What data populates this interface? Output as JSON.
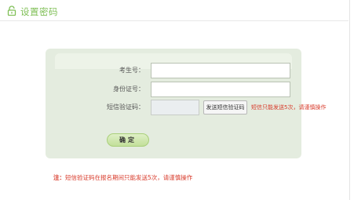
{
  "header": {
    "title": "设置密码"
  },
  "form": {
    "exam_id_label": "考生号：",
    "id_card_label": "身份证号：",
    "sms_code_label": "短信验证码：",
    "exam_id_value": "",
    "id_card_value": "",
    "sms_code_value": "",
    "send_code_label": "发送短信验证码",
    "sms_warning": "短信只能发送5次，请谨慎操作",
    "confirm_label": "确定"
  },
  "footnote": {
    "prefix": "注：",
    "text": "短信验证码在报名期间只能发送5次，请谨慎操作"
  },
  "colors": {
    "accent_green": "#7fbf56",
    "warning_red": "#d83a2a",
    "panel_bg": "#e4ecdf"
  }
}
